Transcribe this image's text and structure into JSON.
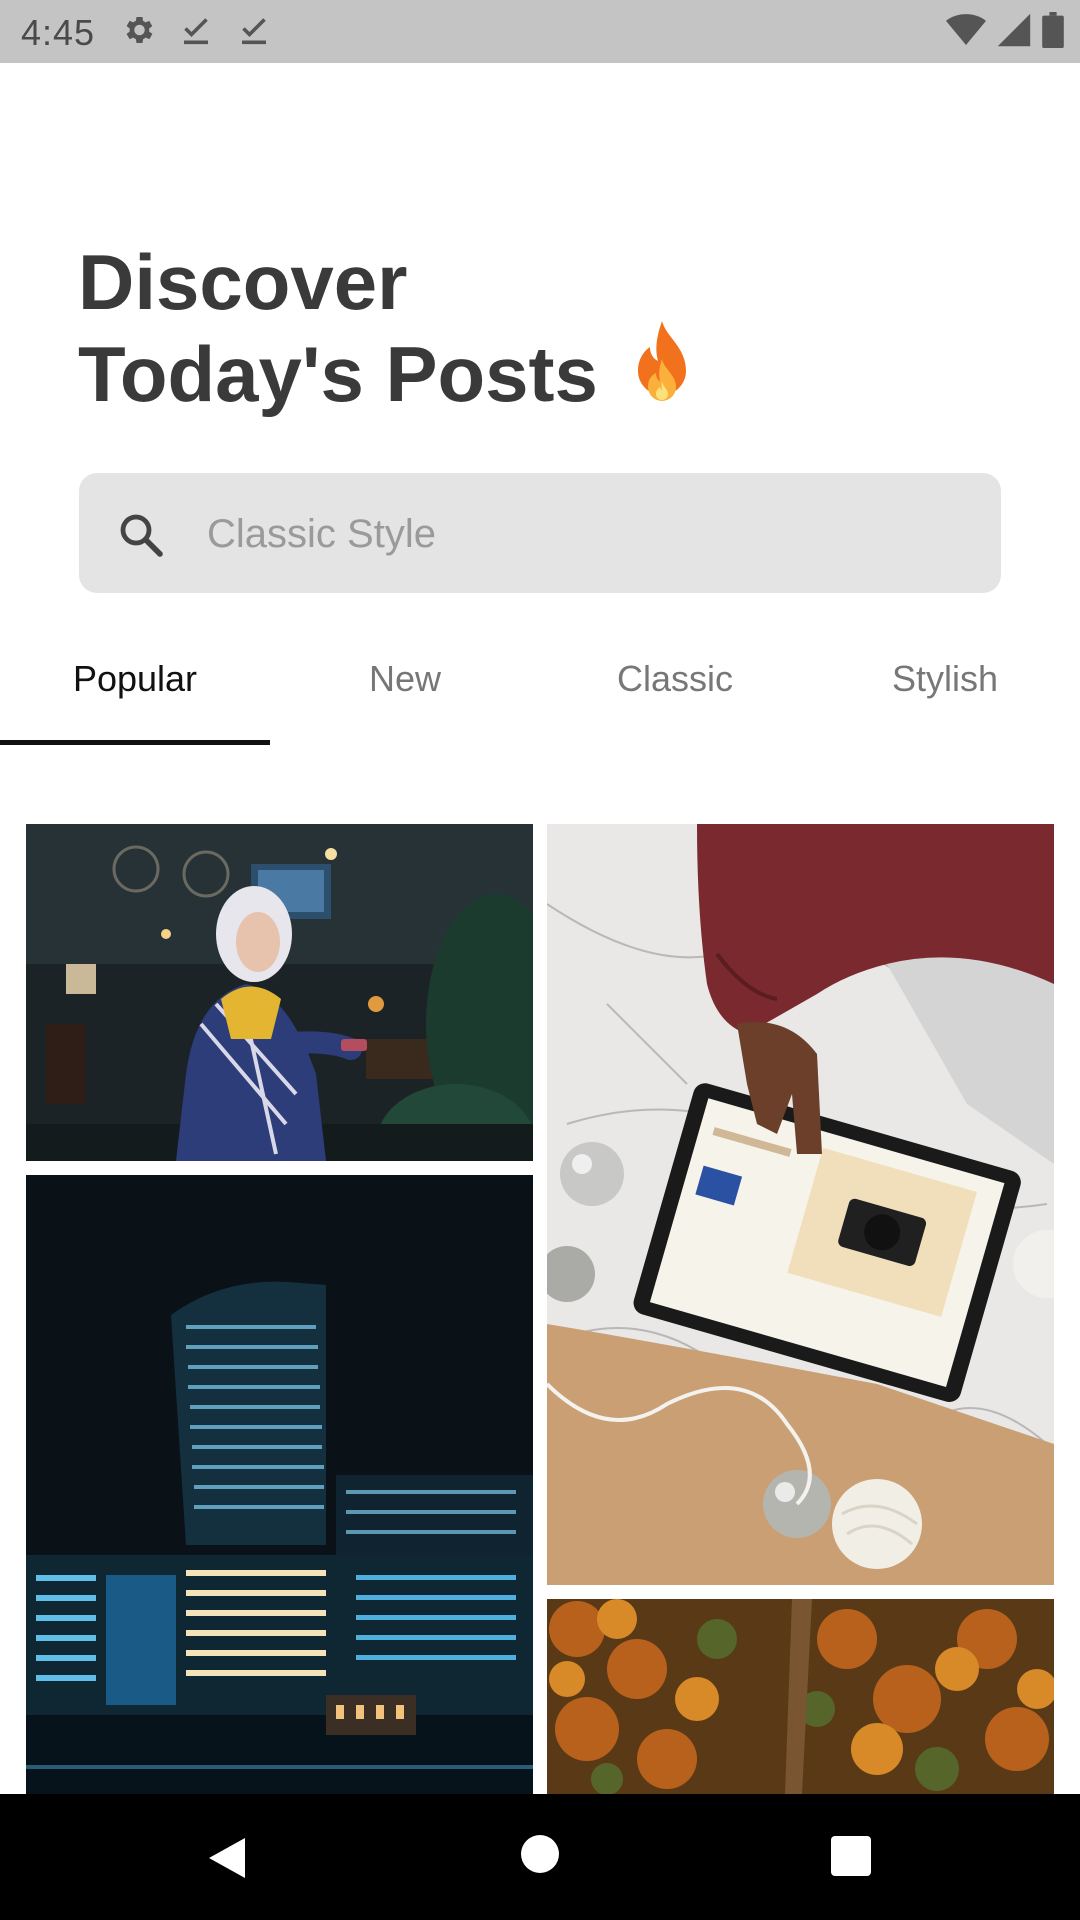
{
  "status_bar": {
    "time": "4:45",
    "left_icons": [
      "gear-icon",
      "download-done-icon",
      "download-done-icon"
    ],
    "right_icons": [
      "wifi-icon",
      "signal-icon",
      "battery-icon"
    ]
  },
  "header": {
    "title_line1": "Discover",
    "title_line2": "Today's Posts",
    "title_icon": "fire-icon"
  },
  "search": {
    "placeholder": "Classic Style",
    "value": ""
  },
  "tabs": [
    {
      "label": "Popular",
      "active": true
    },
    {
      "label": "New",
      "active": false
    },
    {
      "label": "Classic",
      "active": false
    },
    {
      "label": "Stylish",
      "active": false
    }
  ],
  "posts": [
    {
      "subject": "woman-in-cafe-photo"
    },
    {
      "subject": "night-city-buildings-photo"
    },
    {
      "subject": "tablet-camera-desk-photo"
    },
    {
      "subject": "autumn-forest-aerial-photo"
    }
  ],
  "navigation": [
    "back-icon",
    "home-icon",
    "recents-icon"
  ],
  "colors": {
    "status_bar": "#c4c4c4",
    "title": "#3a3a3a",
    "search_bg": "#e4e4e4",
    "tab_active": "#111111",
    "tab_inactive": "#777777",
    "nav_bar": "#000000"
  }
}
